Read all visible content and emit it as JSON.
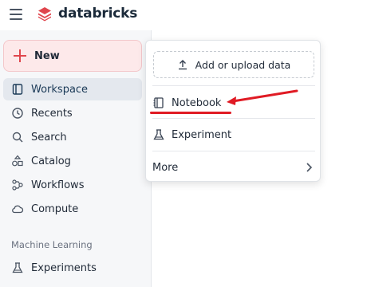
{
  "app": {
    "brand": "databricks",
    "brand_color": "#e0464d"
  },
  "sidebar": {
    "new_label": "New",
    "items": [
      {
        "label": "Workspace",
        "icon": "workspace-icon",
        "active": true
      },
      {
        "label": "Recents",
        "icon": "clock-icon"
      },
      {
        "label": "Search",
        "icon": "search-icon"
      },
      {
        "label": "Catalog",
        "icon": "catalog-icon"
      },
      {
        "label": "Workflows",
        "icon": "workflows-icon"
      },
      {
        "label": "Compute",
        "icon": "cloud-icon"
      }
    ],
    "section_ml": "Machine Learning",
    "ml_items": [
      {
        "label": "Experiments",
        "icon": "flask-icon"
      }
    ]
  },
  "new_menu": {
    "upload_label": "Add or upload data",
    "items": [
      {
        "label": "Notebook",
        "icon": "notebook-icon"
      },
      {
        "label": "Experiment",
        "icon": "flask-icon"
      },
      {
        "label": "More",
        "icon": "chevron-right-icon"
      }
    ]
  },
  "annotation": {
    "color": "#e01b24"
  }
}
